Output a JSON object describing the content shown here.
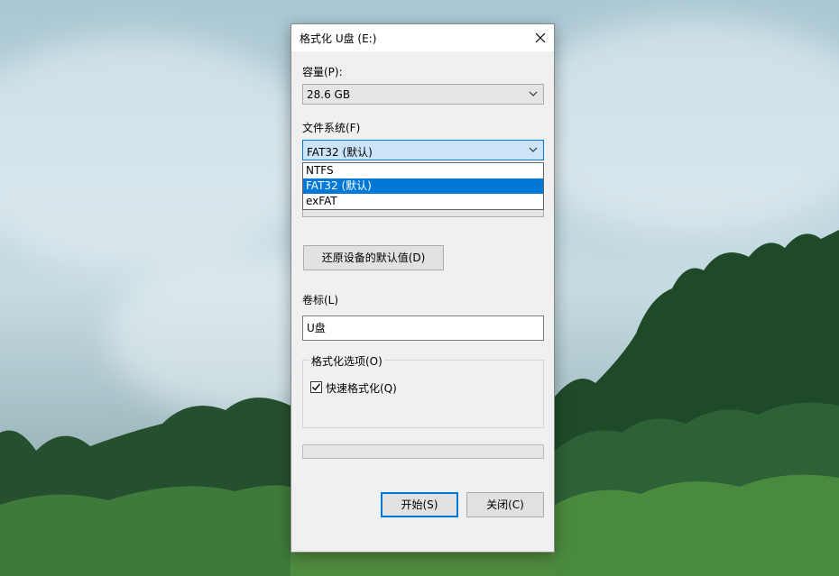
{
  "dialog": {
    "title": "格式化 U盘 (E:)"
  },
  "capacity": {
    "label": "容量(P):",
    "value": "28.6 GB"
  },
  "filesystem": {
    "label": "文件系统(F)",
    "value": "FAT32 (默认)",
    "options": [
      "NTFS",
      "FAT32 (默认)",
      "exFAT"
    ],
    "selected_index": 1
  },
  "restore_defaults_label": "还原设备的默认值(D)",
  "volume": {
    "label": "卷标(L)",
    "value": "U盘"
  },
  "format_options": {
    "title": "格式化选项(O)",
    "quick_format_label": "快速格式化(Q)",
    "quick_format_checked": true
  },
  "progress": {
    "fraction": 0
  },
  "buttons": {
    "start": "开始(S)",
    "close": "关闭(C)"
  },
  "colors": {
    "accent": "#0078d7",
    "dialog_bg": "#f0f0f0"
  },
  "icons": {
    "close": "close-icon",
    "chevron": "chevron-down-icon",
    "check": "checkmark-icon"
  }
}
